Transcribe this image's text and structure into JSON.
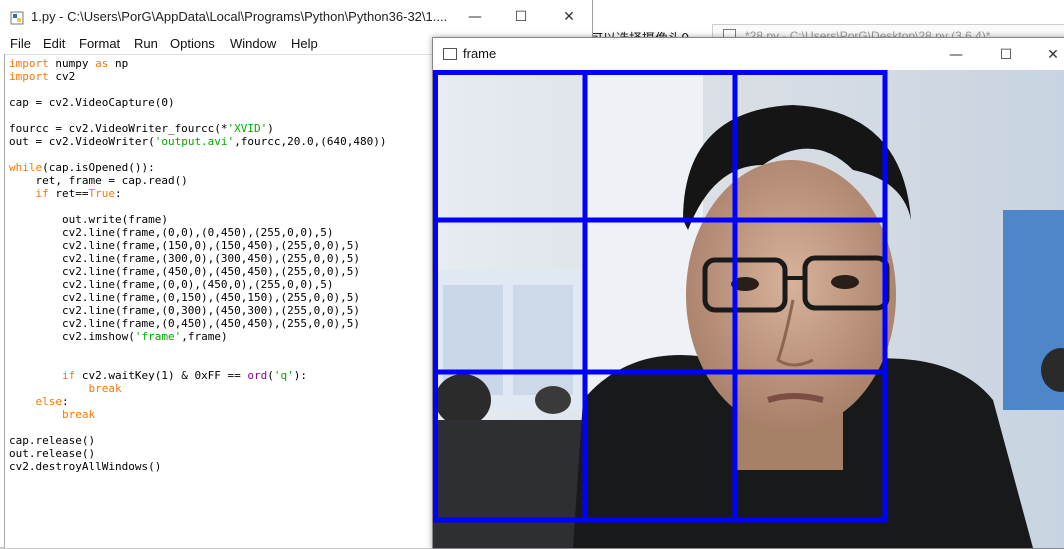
{
  "background": {
    "cjk_text": "可以选择摄像头0",
    "tab_title": "*28.py - C:\\Users\\PorG\\Desktop\\28.py (3.6.4)*"
  },
  "idle": {
    "title": "1.py - C:\\Users\\PorG\\AppData\\Local\\Programs\\Python\\Python36-32\\1....",
    "controls": {
      "minimize": "—",
      "maximize": "☐",
      "close": "✕"
    },
    "menu": [
      "File",
      "Edit",
      "Format",
      "Run",
      "Options",
      "Window",
      "Help"
    ]
  },
  "frame_window": {
    "title": "frame",
    "controls": {
      "minimize": "—",
      "maximize": "☐",
      "close": "✕"
    },
    "grid_color": "#0000ff"
  },
  "colors": {
    "keyword": "#ff7700",
    "string": "#00aa00",
    "builtin": "#900090"
  },
  "code_lines": [
    [
      {
        "t": "import",
        "c": "kw"
      },
      {
        "t": " numpy "
      },
      {
        "t": "as",
        "c": "kw"
      },
      {
        "t": " np"
      }
    ],
    [
      {
        "t": "import",
        "c": "kw"
      },
      {
        "t": " cv2"
      }
    ],
    [],
    [
      {
        "t": "cap = cv2.VideoCapture(0)"
      }
    ],
    [],
    [
      {
        "t": "fourcc = cv2.VideoWriter_fourcc(*"
      },
      {
        "t": "'XVID'",
        "c": "str"
      },
      {
        "t": ")"
      }
    ],
    [
      {
        "t": "out = cv2.VideoWriter("
      },
      {
        "t": "'output.avi'",
        "c": "str"
      },
      {
        "t": ",fourcc,20.0,(640,480))"
      }
    ],
    [],
    [
      {
        "t": "while",
        "c": "kw"
      },
      {
        "t": "(cap.isOpened()):"
      }
    ],
    [
      {
        "t": "    ret, frame = cap.read()"
      }
    ],
    [
      {
        "t": "    "
      },
      {
        "t": "if",
        "c": "kw"
      },
      {
        "t": " ret=="
      },
      {
        "t": "True",
        "c": "kw"
      },
      {
        "t": ":"
      }
    ],
    [],
    [
      {
        "t": "        out.write(frame)"
      }
    ],
    [
      {
        "t": "        cv2.line(frame,(0,0),(0,450),(255,0,0),5)"
      }
    ],
    [
      {
        "t": "        cv2.line(frame,(150,0),(150,450),(255,0,0),5)"
      }
    ],
    [
      {
        "t": "        cv2.line(frame,(300,0),(300,450),(255,0,0),5)"
      }
    ],
    [
      {
        "t": "        cv2.line(frame,(450,0),(450,450),(255,0,0),5)"
      }
    ],
    [
      {
        "t": "        cv2.line(frame,(0,0),(450,0),(255,0,0),5)"
      }
    ],
    [
      {
        "t": "        cv2.line(frame,(0,150),(450,150),(255,0,0),5)"
      }
    ],
    [
      {
        "t": "        cv2.line(frame,(0,300),(450,300),(255,0,0),5)"
      }
    ],
    [
      {
        "t": "        cv2.line(frame,(0,450),(450,450),(255,0,0),5)"
      }
    ],
    [
      {
        "t": "        cv2.imshow("
      },
      {
        "t": "'frame'",
        "c": "str"
      },
      {
        "t": ",frame)"
      }
    ],
    [],
    [],
    [
      {
        "t": "        "
      },
      {
        "t": "if",
        "c": "kw"
      },
      {
        "t": " cv2.waitKey(1) & 0xFF == "
      },
      {
        "t": "ord",
        "c": "bi"
      },
      {
        "t": "("
      },
      {
        "t": "'q'",
        "c": "str"
      },
      {
        "t": "):"
      }
    ],
    [
      {
        "t": "            "
      },
      {
        "t": "break",
        "c": "kw"
      }
    ],
    [
      {
        "t": "    "
      },
      {
        "t": "else",
        "c": "kw"
      },
      {
        "t": ":"
      }
    ],
    [
      {
        "t": "        "
      },
      {
        "t": "break",
        "c": "kw"
      }
    ],
    [],
    [
      {
        "t": "cap.release()"
      }
    ],
    [
      {
        "t": "out.release()"
      }
    ],
    [
      {
        "t": "cv2.destroyAllWindows()"
      }
    ]
  ]
}
